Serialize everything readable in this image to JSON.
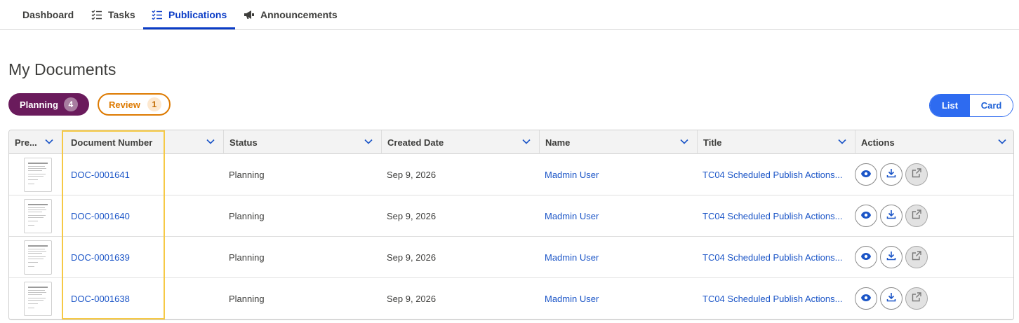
{
  "nav": {
    "tabs": [
      {
        "label": "Dashboard",
        "icon": "none"
      },
      {
        "label": "Tasks",
        "icon": "list-check-icon"
      },
      {
        "label": "Publications",
        "icon": "list-check-icon",
        "active": true
      },
      {
        "label": "Announcements",
        "icon": "megaphone-icon"
      }
    ]
  },
  "page": {
    "title": "My Documents"
  },
  "filters": {
    "planning": {
      "label": "Planning",
      "count": "4",
      "color": "#6a1b5c"
    },
    "review": {
      "label": "Review",
      "count": "1",
      "color": "#dd7a01"
    }
  },
  "view_toggle": {
    "list": "List",
    "card": "Card",
    "selected": "List"
  },
  "table": {
    "columns": [
      "Pre...",
      "Document Number",
      "Status",
      "Created Date",
      "Name",
      "Title",
      "Actions"
    ],
    "rows": [
      {
        "doc_number": "DOC-0001641",
        "status": "Planning",
        "created": "Sep 9, 2026",
        "name": "Madmin User",
        "title": "TC04 Scheduled Publish Actions..."
      },
      {
        "doc_number": "DOC-0001640",
        "status": "Planning",
        "created": "Sep 9, 2026",
        "name": "Madmin User",
        "title": "TC04 Scheduled Publish Actions..."
      },
      {
        "doc_number": "DOC-0001639",
        "status": "Planning",
        "created": "Sep 9, 2026",
        "name": "Madmin User",
        "title": "TC04 Scheduled Publish Actions..."
      },
      {
        "doc_number": "DOC-0001638",
        "status": "Planning",
        "created": "Sep 9, 2026",
        "name": "Madmin User",
        "title": "TC04 Scheduled Publish Actions..."
      }
    ],
    "actions": [
      "eye-icon",
      "download-icon",
      "external-link-icon"
    ]
  }
}
